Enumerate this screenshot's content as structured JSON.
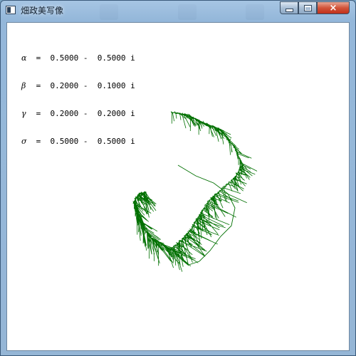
{
  "window": {
    "title": "畑政美写像",
    "controls": {
      "minimize": "minimize",
      "maximize": "maximize",
      "close": "×"
    }
  },
  "parameters": [
    {
      "symbol": "α",
      "text": " =  0.5000 -  0.5000 i"
    },
    {
      "symbol": "β",
      "text": " =  0.2000 -  0.1000 i"
    },
    {
      "symbol": "γ",
      "text": " =  0.2000 -  0.2000 i"
    },
    {
      "symbol": "σ",
      "text": " =  0.5000 -  0.5000 i"
    }
  ],
  "plot": {
    "color": "#007000",
    "iterations": 30000
  },
  "colors": {
    "background": "#ffffff",
    "text": "#000000",
    "title_bar": "#a9c6e2"
  }
}
